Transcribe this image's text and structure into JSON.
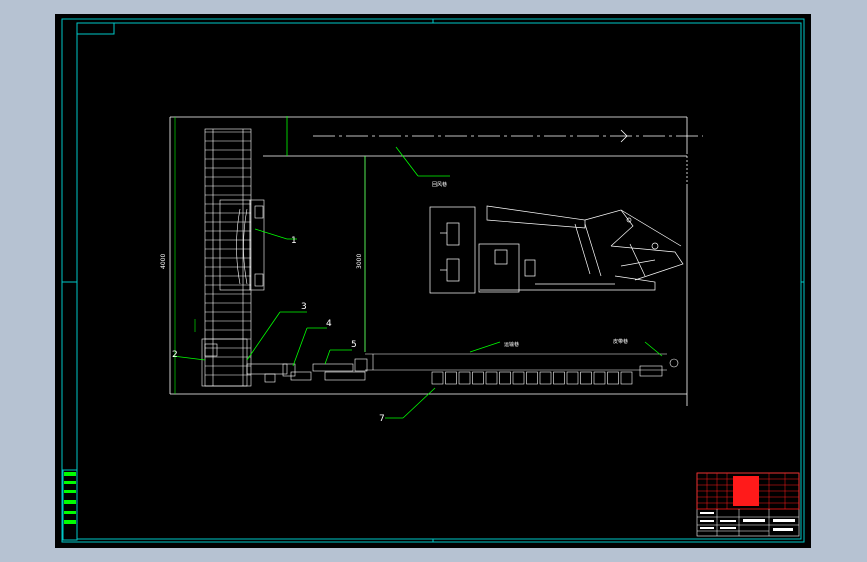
{
  "drawing": {
    "callouts": [
      "1",
      "2",
      "3",
      "4",
      "5",
      "7"
    ],
    "dimension_overall": "4000",
    "dimension_inner": "3000",
    "annotations": {
      "return_airway": "回风巷",
      "transport_lane": "运输巷",
      "belt_lane": "皮带巷"
    }
  },
  "colors": {
    "background": "#000000",
    "frame": "#00c8c8",
    "geometry": "#ffffff",
    "leader": "#00ff00",
    "title_block_red": "#ff1a1a"
  }
}
